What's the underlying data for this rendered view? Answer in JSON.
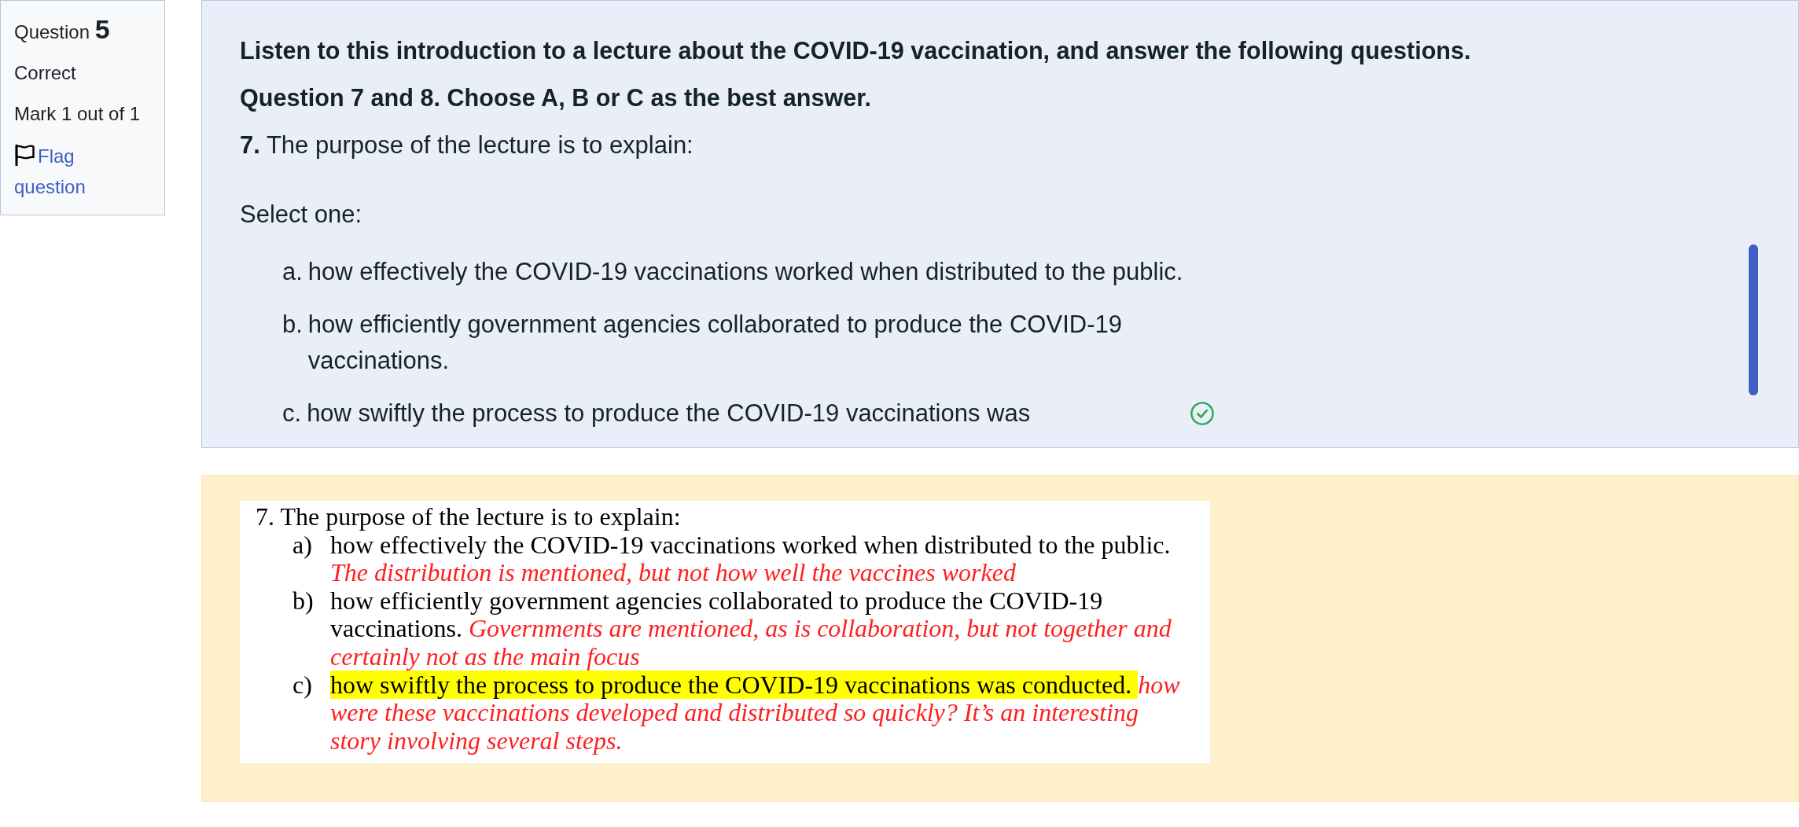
{
  "question_info": {
    "label": "Question",
    "number": "5",
    "state": "Correct",
    "mark": "Mark 1 out of 1",
    "flag_link": "Flag question",
    "flagged": false
  },
  "question": {
    "intro": "Listen to this introduction to a lecture about the COVID-19 vaccination, and answer the following questions.",
    "instruction": "Question 7 and 8. Choose A, B or C as the best answer.",
    "prompt": "**7.** The purpose of the lecture is to explain:",
    "select_label": "Select one:",
    "options": [
      {
        "letter": "a.",
        "text": "how effectively the COVID-19 vaccinations worked when distributed to the public.",
        "correct": false
      },
      {
        "letter": "b.",
        "text": "how efficiently government agencies collaborated to produce the COVID-19 vaccinations.",
        "correct": false
      },
      {
        "letter": "c.",
        "text": "how swiftly the process to produce the COVID-19 vaccinations was",
        "correct": true
      }
    ]
  },
  "feedback": {
    "document": {
      "question": "7. The purpose of the lecture is to explain:",
      "answers": [
        {
          "letter": "a)",
          "text": "how effectively the COVID-19 vaccinations worked when distributed to the public.",
          "comment": "The distribution is mentioned, but not how well the vaccines worked",
          "highlighted": false
        },
        {
          "letter": "b)",
          "text": "how efficiently government agencies collaborated to produce the COVID-19 vaccinations.",
          "comment": "Governments are mentioned, as is collaboration, but not together and certainly not as the main focus",
          "highlighted": false
        },
        {
          "letter": "c)",
          "text": "how swiftly the process to produce the COVID-19 vaccinations was conducted.",
          "comment": "how were these vaccinations developed and distributed so quickly? It’s an interesting story involving several steps.",
          "highlighted": true
        }
      ]
    }
  }
}
